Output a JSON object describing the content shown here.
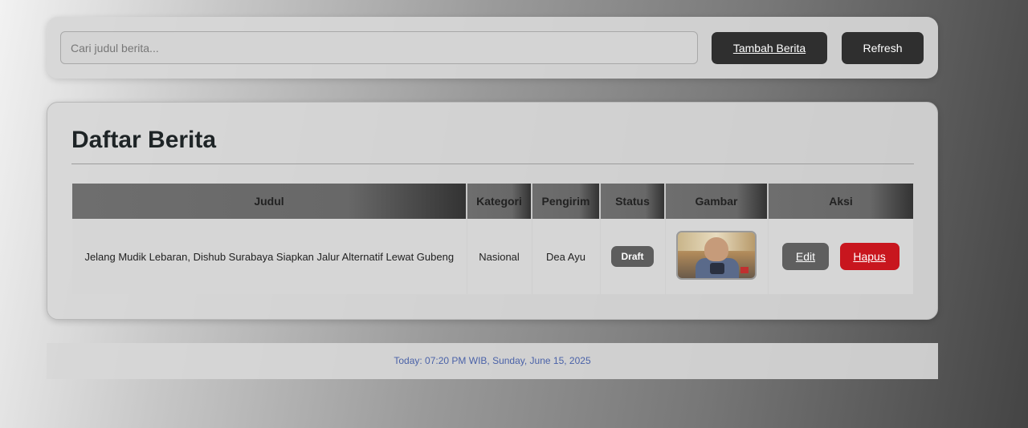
{
  "toolbar": {
    "search_placeholder": "Cari judul berita...",
    "add_label": "Tambah Berita",
    "refresh_label": "Refresh"
  },
  "panel": {
    "title": "Daftar Berita",
    "columns": [
      "Judul",
      "Kategori",
      "Pengirim",
      "Status",
      "Gambar",
      "Aksi"
    ],
    "rows": [
      {
        "judul": "Jelang Mudik Lebaran, Dishub Surabaya Siapkan Jalur Alternatif Lewat Gubeng",
        "kategori": "Nasional",
        "pengirim": "Dea Ayu",
        "status": "Draft",
        "edit_label": "Edit",
        "delete_label": "Hapus"
      }
    ]
  },
  "footer": {
    "text": "Today: 07:20 PM WIB, Sunday, June 15, 2025"
  },
  "colors": {
    "primary_button": "#2f2f2f",
    "delete_button": "#c8161e",
    "footer_text": "#4a62a8"
  }
}
